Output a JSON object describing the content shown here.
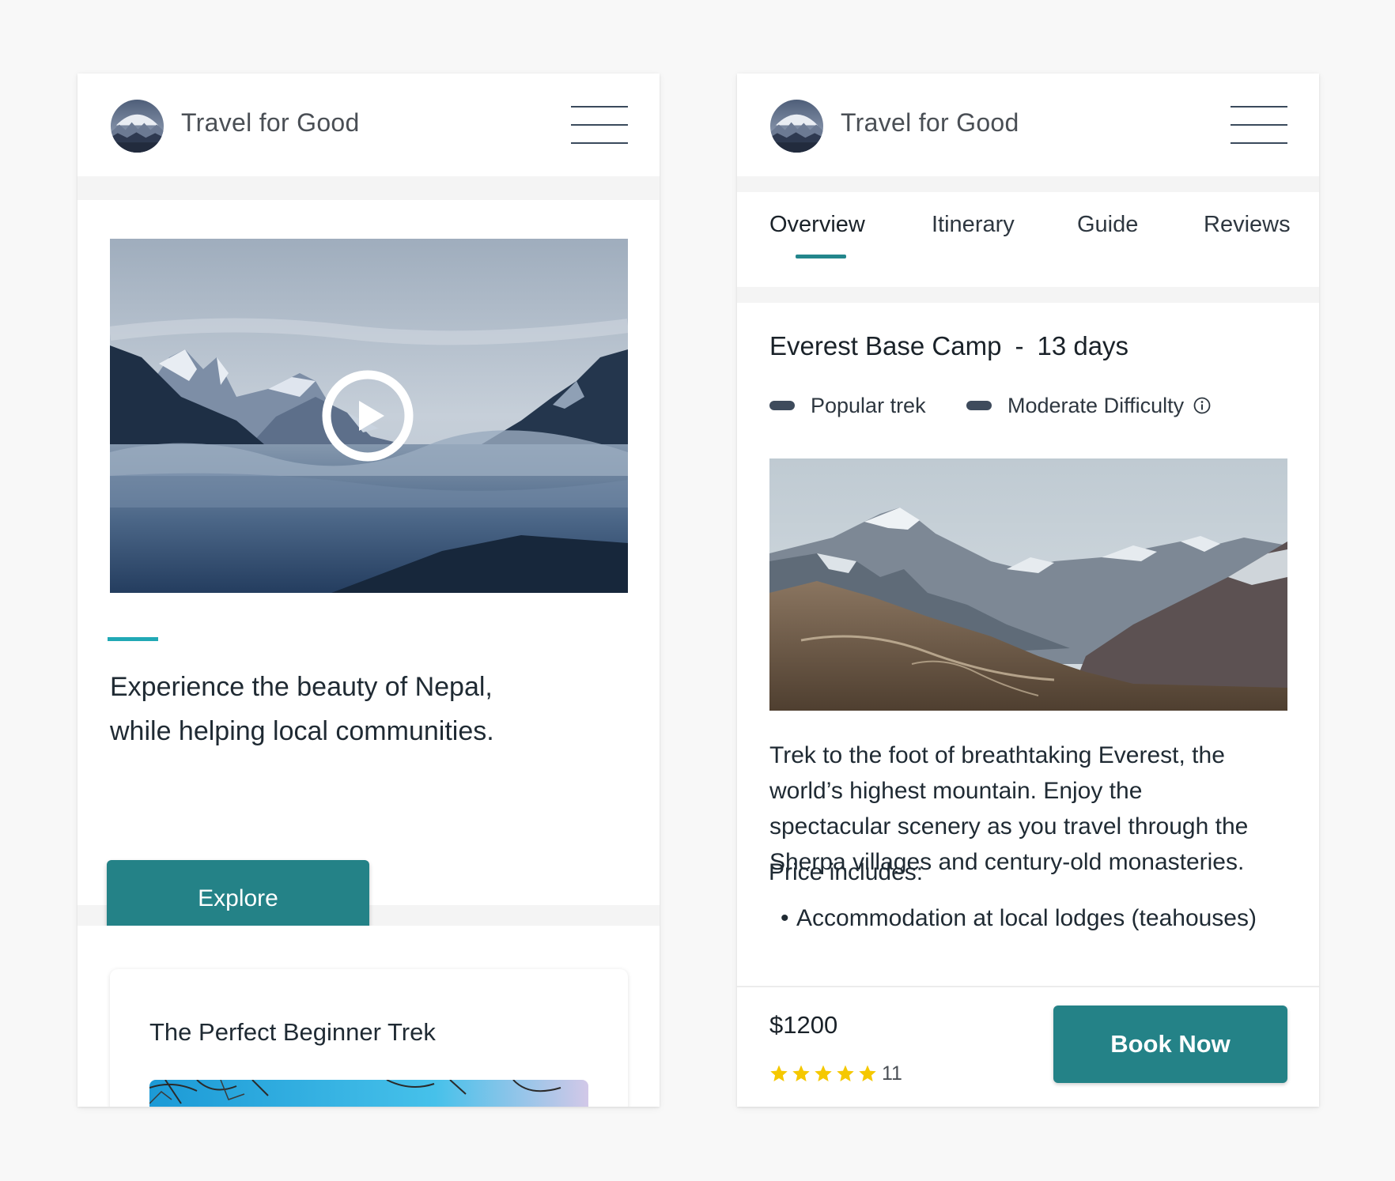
{
  "colors": {
    "background": "#f8f8f8",
    "accent_teal": "#248287",
    "accent_line": "#21a9b5",
    "text_dark": "#1f2a33",
    "tag_pill": "#3e4b5c",
    "star": "#f5c800"
  },
  "home_screen": {
    "header": {
      "logo_icon": "mountain-logo-icon",
      "title": "Travel for Good",
      "menu_icon": "hamburger-menu-icon"
    },
    "hero": {
      "video_icon": "play-icon",
      "headline_lines": [
        "Experience the beauty of Nepal,",
        "while helping local communities."
      ],
      "cta_label": "Explore"
    },
    "featured_card": {
      "title": "The Perfect Beginner Trek"
    }
  },
  "detail_screen": {
    "header": {
      "logo_icon": "mountain-logo-icon",
      "title": "Travel for Good",
      "menu_icon": "hamburger-menu-icon"
    },
    "tabs": [
      {
        "label": "Overview",
        "active": true
      },
      {
        "label": "Itinerary",
        "active": false
      },
      {
        "label": "Guide",
        "active": false
      },
      {
        "label": "Reviews",
        "active": false
      }
    ],
    "trip": {
      "name": "Everest Base Camp",
      "separator": "-",
      "duration": "13 days",
      "tags": [
        "Popular trek",
        "Moderate Difficulty"
      ],
      "info_icon": "info-icon",
      "description_lines": [
        "Trek to the foot of breathtaking Everest, the",
        "world’s highest mountain. Enjoy the",
        "spectacular scenery as you travel through the",
        "Sherpa villages and century-old monasteries."
      ],
      "price_includes_label": "Price includes:",
      "price_includes": [
        "Accommodation at local lodges (teahouses)"
      ]
    },
    "booking": {
      "price": "$1200",
      "rating_stars": 5,
      "review_count": "11",
      "cta_label": "Book Now"
    }
  }
}
